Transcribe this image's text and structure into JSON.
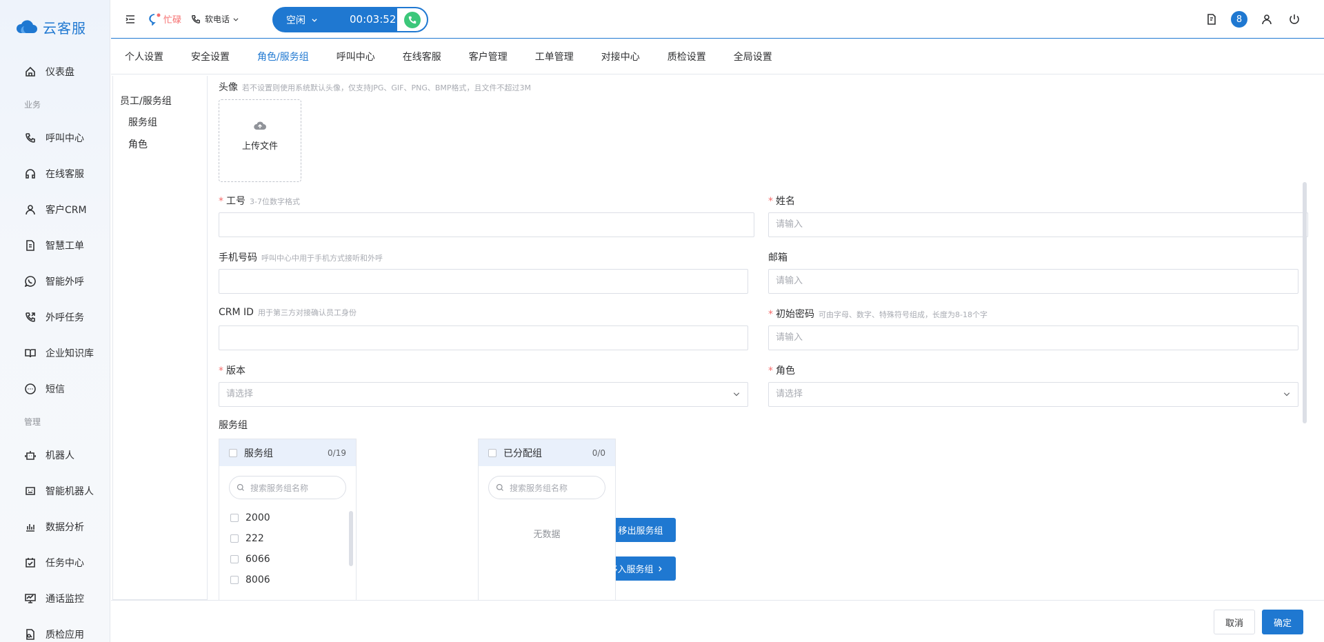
{
  "app": {
    "name": "云客服"
  },
  "sidebar": {
    "items": [
      {
        "label": "仪表盘",
        "icon": "home-icon"
      },
      {
        "section": "业务"
      },
      {
        "label": "呼叫中心",
        "icon": "phone-icon"
      },
      {
        "label": "在线客服",
        "icon": "headset-icon"
      },
      {
        "label": "客户CRM",
        "icon": "user-icon"
      },
      {
        "label": "智慧工单",
        "icon": "ticket-icon"
      },
      {
        "label": "智能外呼",
        "icon": "whatsapp-icon"
      },
      {
        "label": "外呼任务",
        "icon": "phone-out-icon"
      },
      {
        "label": "企业知识库",
        "icon": "book-icon"
      },
      {
        "label": "短信",
        "icon": "sms-icon"
      },
      {
        "section": "管理"
      },
      {
        "label": "机器人",
        "icon": "robot-icon"
      },
      {
        "label": "智能机器人",
        "icon": "bot-icon"
      },
      {
        "label": "数据分析",
        "icon": "bar-chart-icon"
      },
      {
        "label": "任务中心",
        "icon": "task-icon"
      },
      {
        "label": "通话监控",
        "icon": "monitor-icon"
      },
      {
        "label": "质检应用",
        "icon": "inspect-icon"
      }
    ]
  },
  "header": {
    "status": "忙碌",
    "phone_mode": "软电话",
    "call_state": "空闲",
    "call_timer": "00:03:52",
    "notification_count": "8"
  },
  "tabs": [
    {
      "label": "个人设置"
    },
    {
      "label": "安全设置"
    },
    {
      "label": "角色/服务组",
      "active": true
    },
    {
      "label": "呼叫中心"
    },
    {
      "label": "在线客服"
    },
    {
      "label": "客户管理"
    },
    {
      "label": "工单管理"
    },
    {
      "label": "对接中心"
    },
    {
      "label": "质检设置"
    },
    {
      "label": "全局设置"
    }
  ],
  "subnav": {
    "group": "员工/服务组",
    "items": [
      "服务组",
      "角色"
    ]
  },
  "form": {
    "avatar": {
      "label": "头像",
      "hint": "若不设置则使用系统默认头像，仅支持JPG、GIF、PNG、BMP格式，且文件不超过3M",
      "upload": "上传文件"
    },
    "job_no": {
      "label": "工号",
      "hint": "3-7位数字格式",
      "value": ""
    },
    "name": {
      "label": "姓名",
      "placeholder": "请输入"
    },
    "mobile": {
      "label": "手机号码",
      "hint": "呼叫中心中用于手机方式接听和外呼",
      "value": ""
    },
    "email": {
      "label": "邮箱",
      "placeholder": "请输入"
    },
    "crm_id": {
      "label": "CRM ID",
      "hint": "用于第三方对接确认员工身份",
      "value": ""
    },
    "password": {
      "label": "初始密码",
      "hint": "可由字母、数字、特殊符号组成，长度为8-18个字",
      "placeholder": "请输入"
    },
    "version": {
      "label": "版本",
      "placeholder": "请选择"
    },
    "role": {
      "label": "角色",
      "placeholder": "请选择"
    },
    "service_group": {
      "label": "服务组",
      "left": {
        "title": "服务组",
        "count": "0/19",
        "search_placeholder": "搜索服务组名称",
        "items": [
          "2000",
          "222",
          "6066",
          "8006"
        ]
      },
      "right": {
        "title": "已分配组",
        "count": "0/0",
        "search_placeholder": "搜索服务组名称",
        "empty": "无数据"
      },
      "move_out": "移出服务组",
      "move_in": "移入服务组"
    }
  },
  "footer": {
    "cancel": "取消",
    "confirm": "确定"
  },
  "colors": {
    "primary": "#1f78d1",
    "danger": "#f56c6c",
    "success": "#3cc77a"
  }
}
